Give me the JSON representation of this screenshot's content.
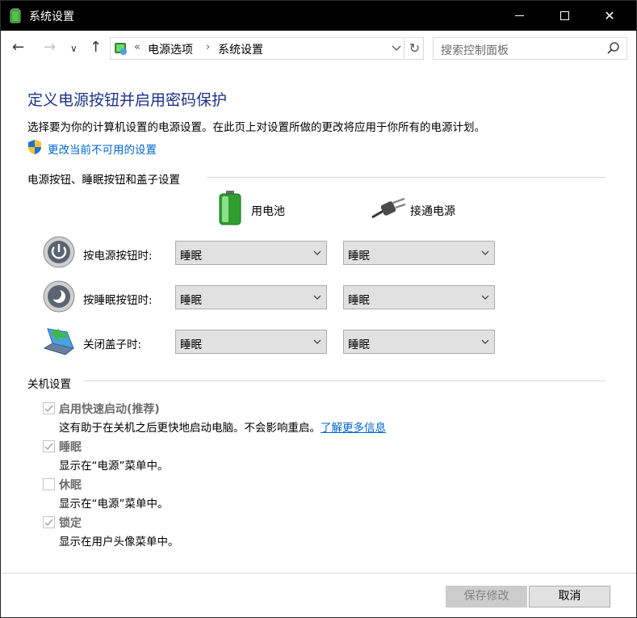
{
  "window": {
    "title": "系统设置",
    "buttons": {
      "minimize": "minimize",
      "maximize": "maximize",
      "close": "✕"
    }
  },
  "addressbar": {
    "overflow": "«",
    "crumbs": [
      "电源选项",
      "系统设置"
    ],
    "separator": "›",
    "search_placeholder": "搜索控制面板"
  },
  "main": {
    "title": "定义电源按钮并启用密码保护",
    "description": "选择要为你的计算机设置的电源设置。在此页上对设置所做的更改将应用于你所有的电源计划。",
    "uac_link": "更改当前不可用的设置",
    "buttons_section": {
      "heading": "电源按钮、睡眠按钮和盖子设置",
      "columns": [
        "用电池",
        "接通电源"
      ],
      "rows": [
        {
          "label": "按电源按钮时:",
          "battery": "睡眠",
          "plugged": "睡眠",
          "icon": "power-button-icon"
        },
        {
          "label": "按睡眠按钮时:",
          "battery": "睡眠",
          "plugged": "睡眠",
          "icon": "sleep-button-icon"
        },
        {
          "label": "关闭盖子时:",
          "battery": "睡眠",
          "plugged": "睡眠",
          "icon": "laptop-lid-icon"
        }
      ]
    },
    "shutdown_section": {
      "heading": "关机设置",
      "items": [
        {
          "label": "启用快速启动(推荐)",
          "checked": true,
          "desc": "这有助于在关机之后更快地启动电脑。不会影响重启。",
          "link": "了解更多信息"
        },
        {
          "label": "睡眠",
          "checked": true,
          "desc": "显示在“电源”菜单中。"
        },
        {
          "label": "休眠",
          "checked": false,
          "desc": "显示在“电源”菜单中。"
        },
        {
          "label": "锁定",
          "checked": true,
          "desc": "显示在用户头像菜单中。"
        }
      ]
    }
  },
  "footer": {
    "save_label": "保存修改",
    "cancel_label": "取消"
  },
  "colors": {
    "title_blue": "#1e3287",
    "link_blue": "#0066cc",
    "titlebar_bg": "#000000"
  }
}
